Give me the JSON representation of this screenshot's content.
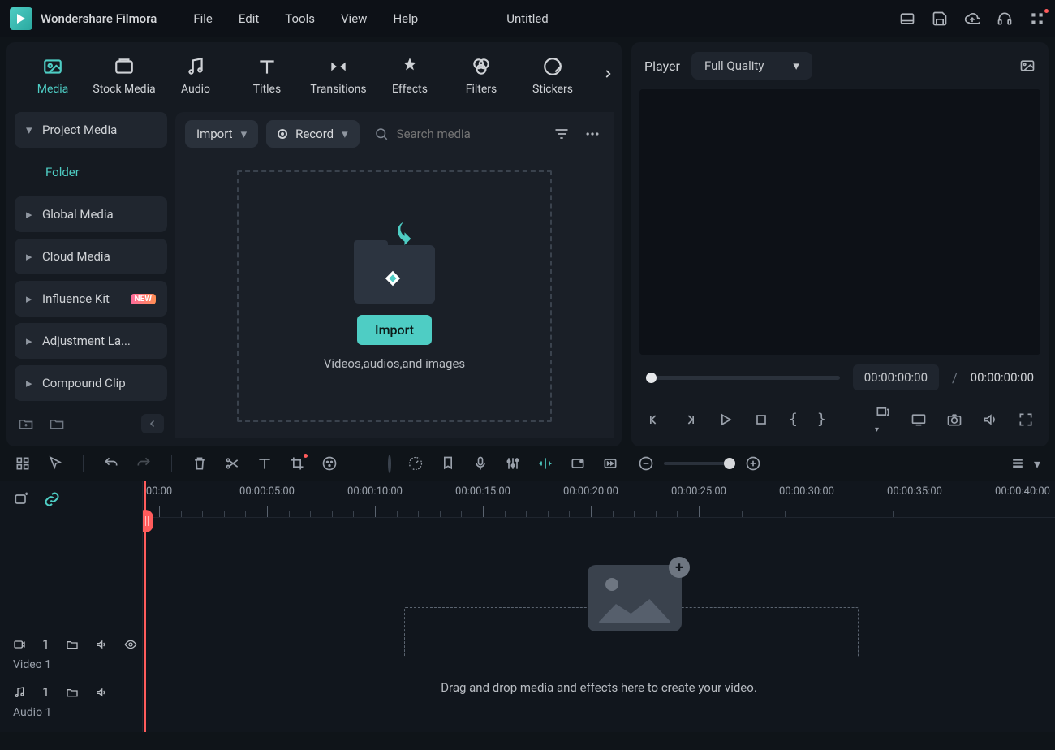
{
  "app": {
    "name": "Wondershare Filmora",
    "document": "Untitled"
  },
  "menus": [
    "File",
    "Edit",
    "Tools",
    "View",
    "Help"
  ],
  "tabs": [
    {
      "key": "media",
      "label": "Media",
      "active": true
    },
    {
      "key": "stock",
      "label": "Stock Media"
    },
    {
      "key": "audio",
      "label": "Audio"
    },
    {
      "key": "titles",
      "label": "Titles"
    },
    {
      "key": "transitions",
      "label": "Transitions"
    },
    {
      "key": "effects",
      "label": "Effects"
    },
    {
      "key": "filters",
      "label": "Filters"
    },
    {
      "key": "stickers",
      "label": "Stickers"
    }
  ],
  "sidebar": {
    "items": [
      {
        "label": "Project Media",
        "expanded": true
      },
      {
        "label": "Folder",
        "sub": true,
        "active": true
      },
      {
        "label": "Global Media"
      },
      {
        "label": "Cloud Media"
      },
      {
        "label": "Influence Kit",
        "badge": "NEW"
      },
      {
        "label": "Adjustment La..."
      },
      {
        "label": "Compound Clip"
      }
    ]
  },
  "browser": {
    "import_label": "Import",
    "record_label": "Record",
    "search_placeholder": "Search media",
    "import_button": "Import",
    "drop_caption": "Videos,audios,and images"
  },
  "player": {
    "label": "Player",
    "quality": "Full Quality",
    "current": "00:00:00:00",
    "total": "00:00:00:00",
    "separator": "/"
  },
  "timeline": {
    "ticks": [
      "00:00",
      "00:00:05:00",
      "00:00:10:00",
      "00:00:15:00",
      "00:00:20:00",
      "00:00:25:00",
      "00:00:30:00",
      "00:00:35:00",
      "00:00:40:00"
    ],
    "tracks": [
      {
        "kind": "video",
        "index": "1",
        "name": "Video 1"
      },
      {
        "kind": "audio",
        "index": "1",
        "name": "Audio 1"
      }
    ],
    "hint": "Drag and drop media and effects here to create your video."
  }
}
